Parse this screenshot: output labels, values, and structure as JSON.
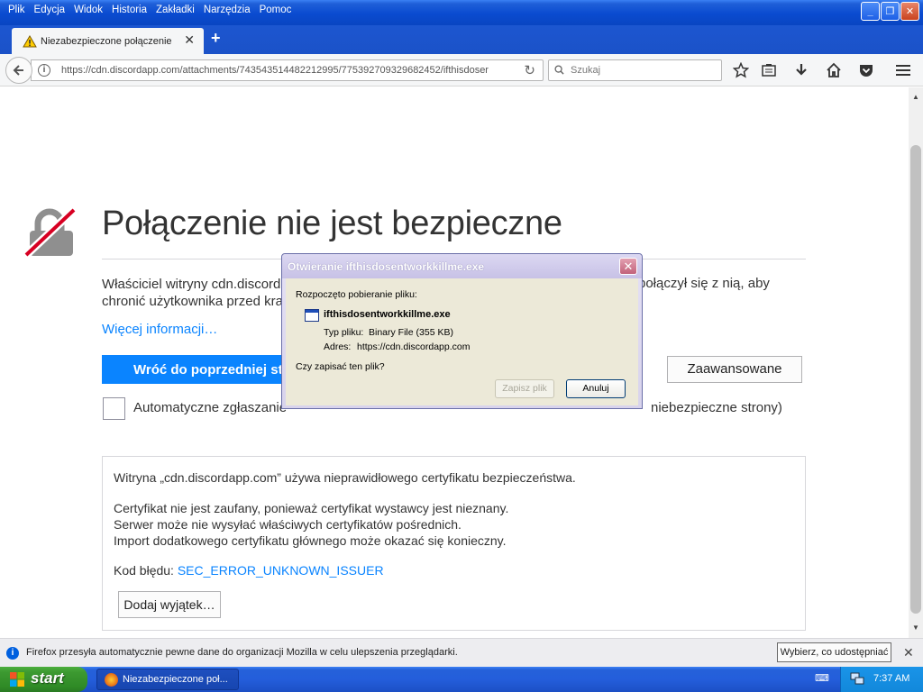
{
  "menu": {
    "items": [
      "Plik",
      "Edycja",
      "Widok",
      "Historia",
      "Zakładki",
      "Narzędzia",
      "Pomoc"
    ]
  },
  "tab": {
    "title": "Niezabezpieczone połączenie",
    "new_tab": "+"
  },
  "nav": {
    "url": "https://cdn.discordapp.com/attachments/743543514482212995/775392709329682452/ifthisdoser",
    "search_placeholder": "Szukaj"
  },
  "page": {
    "title": "Połączenie nie jest bezpieczne",
    "intro": "Właściciel witryny cdn.discordapp.com nieprawidłowo ją skonfigurował, więc Firefox nie połączył się z nią, aby chronić użytkownika przed kradzieżą informacji.",
    "intro_visible_left": "Właściciel witryny cdn.discordap",
    "intro_visible_left2": "chronić użytkownika przed krad",
    "intro_visible_right": "połączył się z nią, aby",
    "more_info": "Więcej informacji…",
    "back_button": "Wróć do poprzedniej strony",
    "advanced_button": "Zaawansowane",
    "report_label": "Automatyczne zgłaszanie",
    "report_label_tail": "niebezpieczne strony)"
  },
  "details": {
    "line1": "Witryna „cdn.discordapp.com” używa nieprawidłowego certyfikatu bezpieczeństwa.",
    "line2": "Certyfikat nie jest zaufany, ponieważ certyfikat wystawcy jest nieznany.",
    "line3": "Serwer może nie wysyłać właściwych certyfikatów pośrednich.",
    "line4": "Import dodatkowego certyfikatu głównego może okazać się konieczny.",
    "error_label": "Kod błędu: ",
    "error_code": "SEC_ERROR_UNKNOWN_ISSUER",
    "add_exception": "Dodaj wyjątek…"
  },
  "dialog": {
    "title": "Otwieranie ifthisdosentworkkillme.exe",
    "started": "Rozpoczęto pobieranie pliku:",
    "filename": "ifthisdosentworkkillme.exe",
    "type_label": "Typ pliku:",
    "type_value": "Binary File (355 KB)",
    "addr_label": "Adres:",
    "addr_value": "https://cdn.discordapp.com",
    "question": "Czy zapisać ten plik?",
    "save": "Zapisz plik",
    "cancel": "Anuluj"
  },
  "notification": {
    "text": "Firefox przesyła automatycznie pewne dane do organizacji Mozilla w celu ulepszenia przeglądarki.",
    "button": "Wybierz, co udostępniać"
  },
  "taskbar": {
    "start": "start",
    "task_label": "Niezabezpieczone poł...",
    "clock": "7:37 AM"
  },
  "colors": {
    "link": "#0a84ff",
    "primary_button": "#0a84ff",
    "xp_blue": "#245edb",
    "start_green": "#3d9a31"
  }
}
